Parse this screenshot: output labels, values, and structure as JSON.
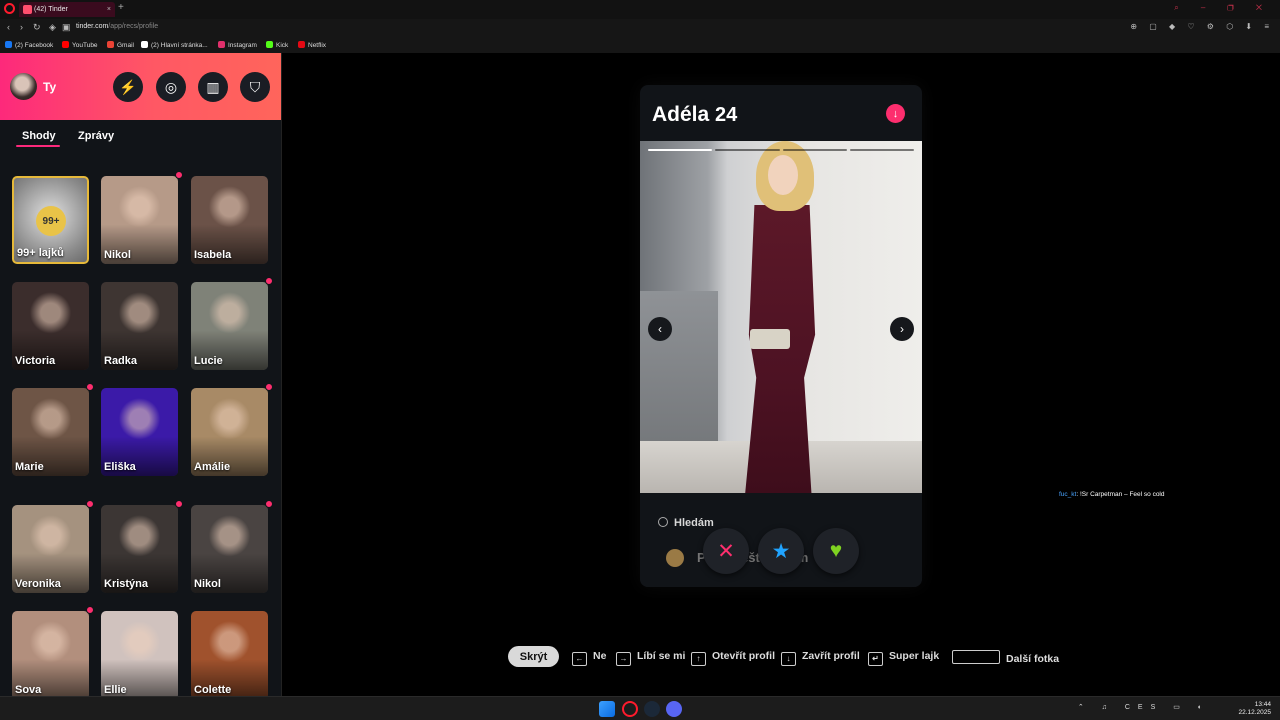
{
  "browser": {
    "tab_title": "(42) Tinder",
    "tab_close": "×",
    "new_tab": "+",
    "url_host": "tinder.com",
    "url_path": "/app/recs/profile",
    "bookmarks": [
      {
        "label": "(2) Facebook",
        "color": "#1877f2"
      },
      {
        "label": "YouTube",
        "color": "#ff0000"
      },
      {
        "label": "Gmail",
        "color": "#ea4335"
      },
      {
        "label": "(2) Hlavní stránka...",
        "color": "#ffffff"
      },
      {
        "label": "Instagram",
        "color": "#e1306c"
      },
      {
        "label": "Kick",
        "color": "#53fc18"
      },
      {
        "label": "Netflix",
        "color": "#e50914"
      }
    ]
  },
  "sidebar": {
    "profile_name": "Ty",
    "header_buttons": [
      "bolt-icon",
      "compass-icon",
      "briefcase-icon",
      "shield-icon"
    ],
    "tabs": [
      "Shody",
      "Zprávy"
    ],
    "likes_badge": "99+",
    "likes_label": "99+ lajků",
    "matches": [
      {
        "name": "Nikol",
        "new": true,
        "color": "#b69a88"
      },
      {
        "name": "Isabela",
        "new": false,
        "color": "#6b5248"
      },
      {
        "name": "Victoria",
        "new": false,
        "color": "#3b2d2c"
      },
      {
        "name": "Radka",
        "new": false,
        "color": "#3e3532"
      },
      {
        "name": "Lucie",
        "new": true,
        "color": "#7f8278"
      },
      {
        "name": "Marie",
        "new": true,
        "color": "#6e5546"
      },
      {
        "name": "Eliška",
        "new": false,
        "color": "#3b1aa8"
      },
      {
        "name": "Amálie",
        "new": true,
        "color": "#a88a66"
      },
      {
        "name": "Veronika",
        "new": true,
        "color": "#a5927f"
      },
      {
        "name": "Kristýna",
        "new": true,
        "color": "#3c3634"
      },
      {
        "name": "Nikol",
        "new": true,
        "color": "#4a4442"
      },
      {
        "name": "Sova",
        "new": true,
        "color": "#b28f7d"
      },
      {
        "name": "Ellie",
        "new": false,
        "color": "#d0c2be"
      },
      {
        "name": "Colette",
        "new": false,
        "color": "#a0522d"
      }
    ]
  },
  "profile": {
    "name": "Adéla",
    "age": "24",
    "looking_label": "Hledám",
    "looking_value": "Pořád ještě nevím"
  },
  "chat_overlay": {
    "user": "fuc_kt",
    "text": ": !Sr Carpetman – Feel so cold"
  },
  "shortcuts": {
    "hide": "Skrýt",
    "items": [
      {
        "key": "←",
        "label": "Ne"
      },
      {
        "key": "→",
        "label": "Líbí se mi"
      },
      {
        "key": "↑",
        "label": "Otevřít profil"
      },
      {
        "key": "↓",
        "label": "Zavřít profil"
      },
      {
        "key": "↵",
        "label": "Super lajk"
      },
      {
        "key": "",
        "label": "Další fotka"
      }
    ]
  },
  "taskbar": {
    "lang": "CES",
    "time": "13:44",
    "date": "22.12.2025"
  }
}
